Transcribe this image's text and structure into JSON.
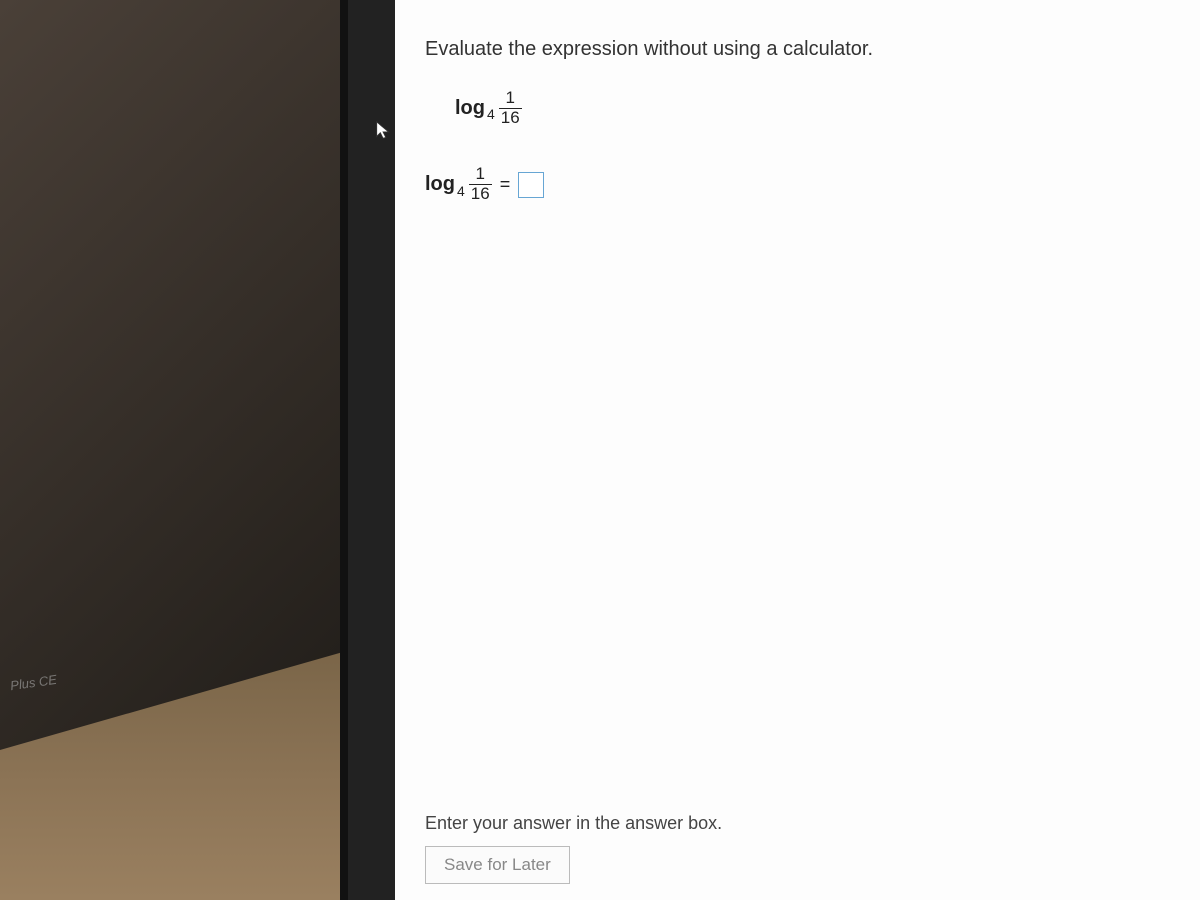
{
  "background": {
    "calculator_label": "Plus CE"
  },
  "question": {
    "prompt": "Evaluate the expression without using a calculator.",
    "expression": {
      "function": "log",
      "base": "4",
      "fraction_numerator": "1",
      "fraction_denominator": "16"
    },
    "answer_line": {
      "function": "log",
      "base": "4",
      "fraction_numerator": "1",
      "fraction_denominator": "16",
      "equals": "=",
      "current_value": ""
    }
  },
  "footer": {
    "hint": "Enter your answer in the answer box.",
    "save_label": "Save for Later"
  }
}
